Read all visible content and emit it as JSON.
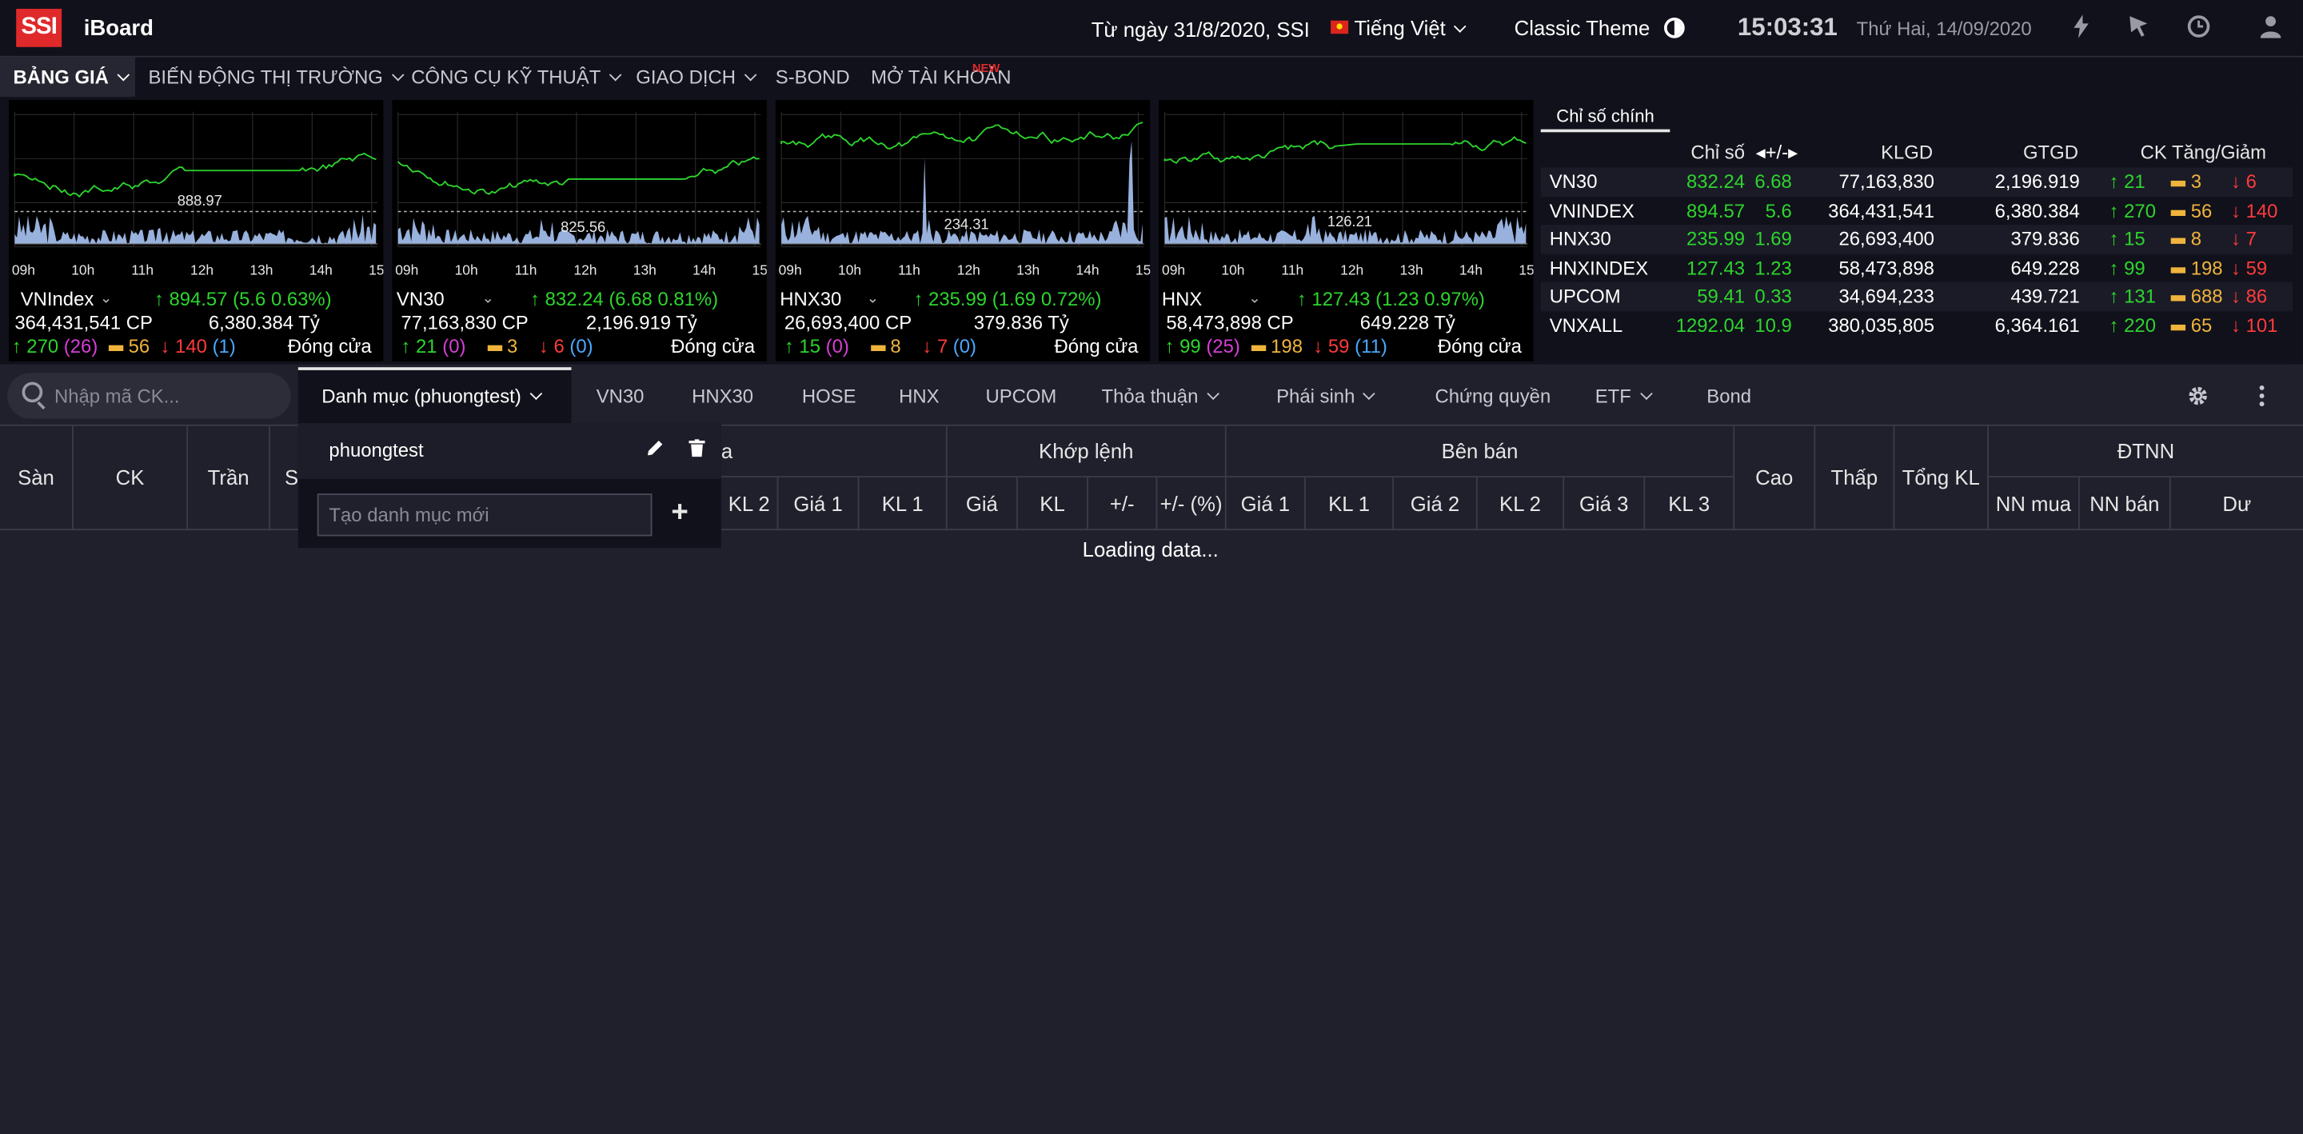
{
  "header": {
    "logo": "SSI",
    "app_name": "iBoard",
    "banner": "Từ ngày 31/8/2020, SSI",
    "language": "Tiếng Việt",
    "theme": "Classic Theme",
    "time": "15:03:31",
    "date": "Thứ Hai, 14/09/2020"
  },
  "icons": {
    "flash": "flash-icon",
    "cursor": "cursor-icon",
    "history": "clock-icon",
    "user": "user-icon",
    "gear": "gear-icon",
    "kebab": "kebab-icon",
    "search": "search-icon",
    "pencil": "pencil-icon",
    "trash": "trash-icon",
    "plus": "plus-icon"
  },
  "menu": [
    {
      "label": "Bảng giá"
    },
    {
      "label": "Biến động thị trường"
    },
    {
      "label": "Công cụ kỹ thuật"
    },
    {
      "label": "Giao dịch"
    },
    {
      "label": "S-BOND"
    },
    {
      "label": "Mở tài khoản"
    }
  ],
  "menu_new_tag": "NEW",
  "panels": [
    {
      "name": "VNIndex",
      "value": "894.57",
      "change": "(5.6",
      "pct": "0.63%)",
      "volume": "364,431,541 CP",
      "value_ty": "6,380.384 Tỷ",
      "up": "270",
      "up_ceil": "(26)",
      "flat": "56",
      "down": "140",
      "down_floor": "(1)",
      "status": "Đóng cửa",
      "ref": "888.97"
    },
    {
      "name": "VN30",
      "value": "832.24",
      "change": "(6.68",
      "pct": "0.81%)",
      "volume": "77,163,830 CP",
      "value_ty": "2,196.919 Tỷ",
      "up": "21",
      "up_ceil": "(0)",
      "flat": "3",
      "down": "6",
      "down_floor": "(0)",
      "status": "Đóng cửa",
      "ref": "825.56"
    },
    {
      "name": "HNX30",
      "value": "235.99",
      "change": "(1.69",
      "pct": "0.72%)",
      "volume": "26,693,400 CP",
      "value_ty": "379.836 Tỷ",
      "up": "15",
      "up_ceil": "(0)",
      "flat": "8",
      "down": "7",
      "down_floor": "(0)",
      "status": "Đóng cửa",
      "ref": "234.31"
    },
    {
      "name": "HNX",
      "value": "127.43",
      "change": "(1.23",
      "pct": "0.97%)",
      "volume": "58,473,898 CP",
      "value_ty": "649.228 Tỷ",
      "up": "99",
      "up_ceil": "(25)",
      "flat": "198",
      "down": "59",
      "down_floor": "(11)",
      "status": "Đóng cửa",
      "ref": "126.21"
    }
  ],
  "chart_hours": [
    "09h",
    "10h",
    "11h",
    "12h",
    "13h",
    "14h",
    "15h"
  ],
  "index_table": {
    "tab": "Chỉ số chính",
    "headers": {
      "index": "Chỉ số",
      "change": "+/-",
      "vol": "KLGD",
      "val": "GTGD",
      "breadth": "CK Tăng/Giảm"
    },
    "rows": [
      {
        "name": "VN30",
        "index": "832.24",
        "change": "6.68",
        "vol": "77,163,830",
        "val": "2,196.919",
        "up": "21",
        "flat": "3",
        "down": "6"
      },
      {
        "name": "VNINDEX",
        "index": "894.57",
        "change": "5.6",
        "vol": "364,431,541",
        "val": "6,380.384",
        "up": "270",
        "flat": "56",
        "down": "140"
      },
      {
        "name": "HNX30",
        "index": "235.99",
        "change": "1.69",
        "vol": "26,693,400",
        "val": "379.836",
        "up": "15",
        "flat": "8",
        "down": "7"
      },
      {
        "name": "HNXINDEX",
        "index": "127.43",
        "change": "1.23",
        "vol": "58,473,898",
        "val": "649.228",
        "up": "99",
        "flat": "198",
        "down": "59"
      },
      {
        "name": "UPCOM",
        "index": "59.41",
        "change": "0.33",
        "vol": "34,694,233",
        "val": "439.721",
        "up": "131",
        "flat": "688",
        "down": "86"
      },
      {
        "name": "VNXALL",
        "index": "1292.04",
        "change": "10.9",
        "vol": "380,035,805",
        "val": "6,364.161",
        "up": "220",
        "flat": "65",
        "down": "101"
      }
    ]
  },
  "search": {
    "placeholder": "Nhập mã CK..."
  },
  "tabs": [
    {
      "label": "Danh mục (phuongtest)"
    },
    {
      "label": "VN30"
    },
    {
      "label": "HNX30"
    },
    {
      "label": "HOSE"
    },
    {
      "label": "HNX"
    },
    {
      "label": "UPCOM"
    },
    {
      "label": "Thỏa thuận"
    },
    {
      "label": "Phái sinh"
    },
    {
      "label": "Chứng quyền"
    },
    {
      "label": "ETF"
    },
    {
      "label": "Bond"
    }
  ],
  "table_headers": {
    "san": "Sàn",
    "ck": "CK",
    "tran": "Trần",
    "s": "S",
    "a": "a",
    "kl2": "KL 2",
    "gia1": "Giá 1",
    "kl1": "KL 1",
    "khop": "Khớp lệnh",
    "gia": "Giá",
    "kl": "KL",
    "pm": "+/-",
    "pmpct": "+/- (%)",
    "benban": "Bên bán",
    "sgia1": "Giá 1",
    "skl1": "KL 1",
    "sgia2": "Giá 2",
    "skl2": "KL 2",
    "sgia3": "Giá 3",
    "skl3": "KL 3",
    "cao": "Cao",
    "thap": "Thấp",
    "tongkl": "Tổng KL",
    "dtnn": "ĐTNN",
    "nnmua": "NN mua",
    "nnban": "NN bán",
    "du": "Dư"
  },
  "loading": "Loading data...",
  "dropdown": {
    "item": "phuongtest",
    "new_placeholder": "Tạo danh mục mới"
  },
  "colors": {
    "up": "#2dd52d",
    "down": "#ff3b3b",
    "flat": "#f0b43c",
    "ceil": "#d63fd6",
    "floor": "#4aa8ff",
    "brand": "#e0292b",
    "bg": "#20202d",
    "panel": "#11111b"
  }
}
